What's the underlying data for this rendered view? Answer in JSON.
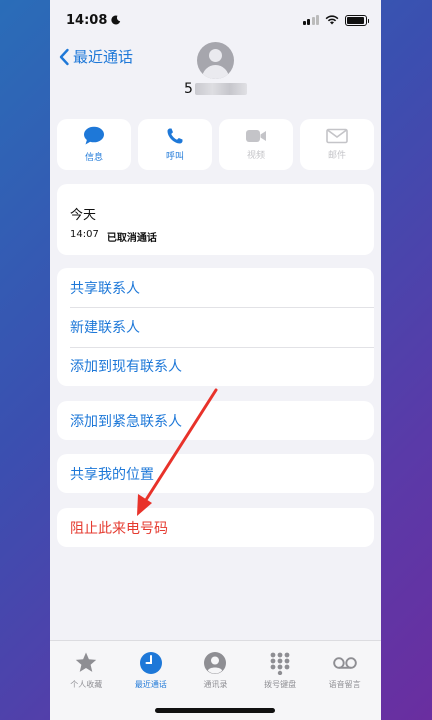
{
  "status_bar": {
    "time": "14:08"
  },
  "header": {
    "back_label": "最近通话",
    "number_prefix": "5"
  },
  "actions": [
    {
      "label": "信息",
      "enabled": true
    },
    {
      "label": "呼叫",
      "enabled": true
    },
    {
      "label": "视频",
      "enabled": false
    },
    {
      "label": "邮件",
      "enabled": false
    }
  ],
  "recent": {
    "day": "今天",
    "time": "14:07",
    "status": "已取消通话"
  },
  "contact_options": [
    {
      "label": "共享联系人"
    },
    {
      "label": "新建联系人"
    },
    {
      "label": "添加到现有联系人"
    }
  ],
  "emergency": {
    "label": "添加到紧急联系人"
  },
  "share_location": {
    "label": "共享我的位置"
  },
  "block": {
    "label": "阻止此来电号码"
  },
  "tabs": [
    {
      "label": "个人收藏",
      "icon": "star-icon",
      "active": false
    },
    {
      "label": "最近通话",
      "icon": "clock-icon",
      "active": true
    },
    {
      "label": "通讯录",
      "icon": "contact-icon",
      "active": false
    },
    {
      "label": "拨号键盘",
      "icon": "keypad-icon",
      "active": false
    },
    {
      "label": "语音留言",
      "icon": "voicemail-icon",
      "active": false
    }
  ],
  "colors": {
    "accent": "#1e78d8",
    "destructive": "#e53b30",
    "annotation": "#e8322a"
  }
}
